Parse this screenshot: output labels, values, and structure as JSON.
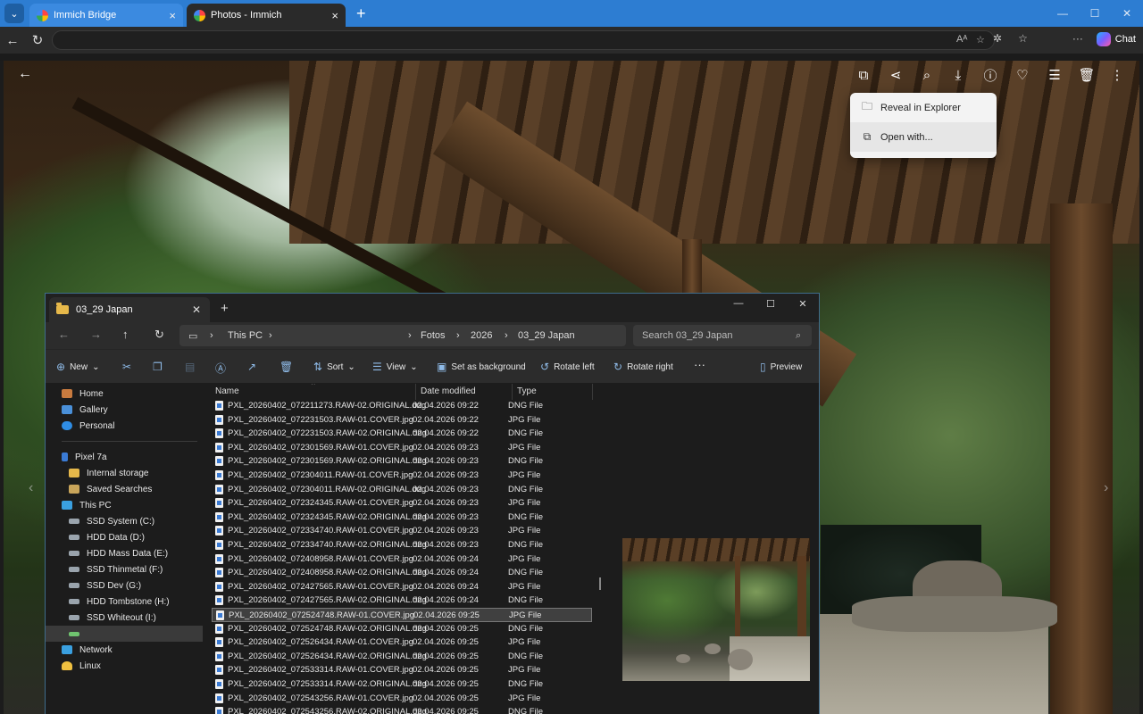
{
  "browser": {
    "tabs": [
      {
        "title": "Immich Bridge"
      },
      {
        "title": "Photos - Immich"
      }
    ],
    "new_tab": "+",
    "toolbar": {
      "chat_label": "Chat"
    }
  },
  "viewer": {
    "menu_items": [
      {
        "label": "Reveal in Explorer",
        "icon": "folder-icon"
      },
      {
        "label": "Open with...",
        "icon": "open-external-icon"
      }
    ],
    "tool_icons": [
      "open-external-icon",
      "share-icon",
      "zoom-icon",
      "download-icon",
      "info-icon",
      "favorite-icon",
      "adjust-icon",
      "delete-icon",
      "more-icon"
    ]
  },
  "explorer": {
    "tab_title": "03_29 Japan",
    "address": {
      "this_pc": "This PC",
      "crumbs": [
        "Fotos",
        "2026",
        "03_29 Japan"
      ]
    },
    "search_placeholder": "Search 03_29 Japan",
    "commands": {
      "new": "New",
      "sort": "Sort",
      "view": "View",
      "set_background": "Set as background",
      "rotate_left": "Rotate left",
      "rotate_right": "Rotate right",
      "more": "···",
      "preview": "Preview"
    },
    "sidebar": {
      "home": "Home",
      "gallery": "Gallery",
      "personal": "Personal",
      "device": "Pixel 7a",
      "internal_storage": "Internal storage",
      "saved_searches": "Saved Searches",
      "this_pc": "This PC",
      "drives": [
        "SSD System (C:)",
        "HDD Data (D:)",
        "HDD Mass Data (E:)",
        "SSD Thinmetal (F:)",
        "SSD Dev (G:)",
        "HDD Tombstone (H:)",
        "SSD Whiteout (I:)"
      ],
      "network": "Network",
      "linux": "Linux"
    },
    "columns": {
      "name": "Name",
      "date": "Date modified",
      "type": "Type"
    },
    "selected_index": 15,
    "files": [
      {
        "name": "PXL_20260402_072211273.RAW-02.ORIGINAL.dng",
        "date": "02.04.2026 09:22",
        "type": "DNG File"
      },
      {
        "name": "PXL_20260402_072231503.RAW-01.COVER.jpg",
        "date": "02.04.2026 09:22",
        "type": "JPG File"
      },
      {
        "name": "PXL_20260402_072231503.RAW-02.ORIGINAL.dng",
        "date": "02.04.2026 09:22",
        "type": "DNG File"
      },
      {
        "name": "PXL_20260402_072301569.RAW-01.COVER.jpg",
        "date": "02.04.2026 09:23",
        "type": "JPG File"
      },
      {
        "name": "PXL_20260402_072301569.RAW-02.ORIGINAL.dng",
        "date": "02.04.2026 09:23",
        "type": "DNG File"
      },
      {
        "name": "PXL_20260402_072304011.RAW-01.COVER.jpg",
        "date": "02.04.2026 09:23",
        "type": "JPG File"
      },
      {
        "name": "PXL_20260402_072304011.RAW-02.ORIGINAL.dng",
        "date": "02.04.2026 09:23",
        "type": "DNG File"
      },
      {
        "name": "PXL_20260402_072324345.RAW-01.COVER.jpg",
        "date": "02.04.2026 09:23",
        "type": "JPG File"
      },
      {
        "name": "PXL_20260402_072324345.RAW-02.ORIGINAL.dng",
        "date": "02.04.2026 09:23",
        "type": "DNG File"
      },
      {
        "name": "PXL_20260402_072334740.RAW-01.COVER.jpg",
        "date": "02.04.2026 09:23",
        "type": "JPG File"
      },
      {
        "name": "PXL_20260402_072334740.RAW-02.ORIGINAL.dng",
        "date": "02.04.2026 09:23",
        "type": "DNG File"
      },
      {
        "name": "PXL_20260402_072408958.RAW-01.COVER.jpg",
        "date": "02.04.2026 09:24",
        "type": "JPG File"
      },
      {
        "name": "PXL_20260402_072408958.RAW-02.ORIGINAL.dng",
        "date": "02.04.2026 09:24",
        "type": "DNG File"
      },
      {
        "name": "PXL_20260402_072427565.RAW-01.COVER.jpg",
        "date": "02.04.2026 09:24",
        "type": "JPG File"
      },
      {
        "name": "PXL_20260402_072427565.RAW-02.ORIGINAL.dng",
        "date": "02.04.2026 09:24",
        "type": "DNG File"
      },
      {
        "name": "PXL_20260402_072524748.RAW-01.COVER.jpg",
        "date": "02.04.2026 09:25",
        "type": "JPG File"
      },
      {
        "name": "PXL_20260402_072524748.RAW-02.ORIGINAL.dng",
        "date": "02.04.2026 09:25",
        "type": "DNG File"
      },
      {
        "name": "PXL_20260402_072526434.RAW-01.COVER.jpg",
        "date": "02.04.2026 09:25",
        "type": "JPG File"
      },
      {
        "name": "PXL_20260402_072526434.RAW-02.ORIGINAL.dng",
        "date": "02.04.2026 09:25",
        "type": "DNG File"
      },
      {
        "name": "PXL_20260402_072533314.RAW-01.COVER.jpg",
        "date": "02.04.2026 09:25",
        "type": "JPG File"
      },
      {
        "name": "PXL_20260402_072533314.RAW-02.ORIGINAL.dng",
        "date": "02.04.2026 09:25",
        "type": "DNG File"
      },
      {
        "name": "PXL_20260402_072543256.RAW-01.COVER.jpg",
        "date": "02.04.2026 09:25",
        "type": "JPG File"
      },
      {
        "name": "PXL_20260402_072543256.RAW-02.ORIGINAL.dng",
        "date": "02.04.2026 09:25",
        "type": "DNG File"
      }
    ]
  }
}
